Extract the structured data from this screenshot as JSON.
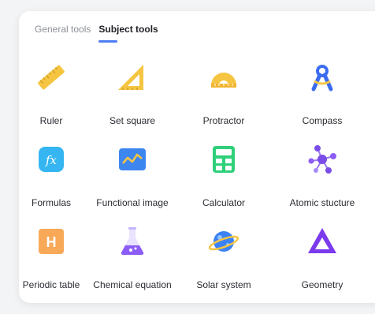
{
  "tabs": [
    {
      "label": "General tools",
      "active": false
    },
    {
      "label": "Subject tools",
      "active": true
    }
  ],
  "tools": [
    {
      "label": "Ruler",
      "icon": "ruler-icon"
    },
    {
      "label": "Set square",
      "icon": "set-square-icon"
    },
    {
      "label": "Protractor",
      "icon": "protractor-icon"
    },
    {
      "label": "Compass",
      "icon": "compass-icon"
    },
    {
      "label": "Formulas",
      "icon": "formulas-icon"
    },
    {
      "label": "Functional image",
      "icon": "functional-image-icon"
    },
    {
      "label": "Calculator",
      "icon": "calculator-icon"
    },
    {
      "label": "Atomic stucture",
      "icon": "atomic-structure-icon"
    },
    {
      "label": "Periodic table",
      "icon": "periodic-table-icon"
    },
    {
      "label": "Chemical equation",
      "icon": "chemical-equation-icon"
    },
    {
      "label": "Solar system",
      "icon": "solar-system-icon"
    },
    {
      "label": "Geometry",
      "icon": "geometry-icon"
    }
  ],
  "periodic_table_symbol": "H",
  "formula_symbol": "fx",
  "colors": {
    "accent": "#4f7df2",
    "ruler": "#f5c542",
    "protractor": "#f5c542",
    "compass": "#3b6cf0",
    "formulas": "#35b6f2",
    "functional": "#3d86f0",
    "calculator": "#2fd07a",
    "atomic": "#7a4de8",
    "periodic": "#f7a957",
    "chemical": "#8b5cf6",
    "solar": "#3b82f6",
    "geometry": "#7c3aed"
  }
}
